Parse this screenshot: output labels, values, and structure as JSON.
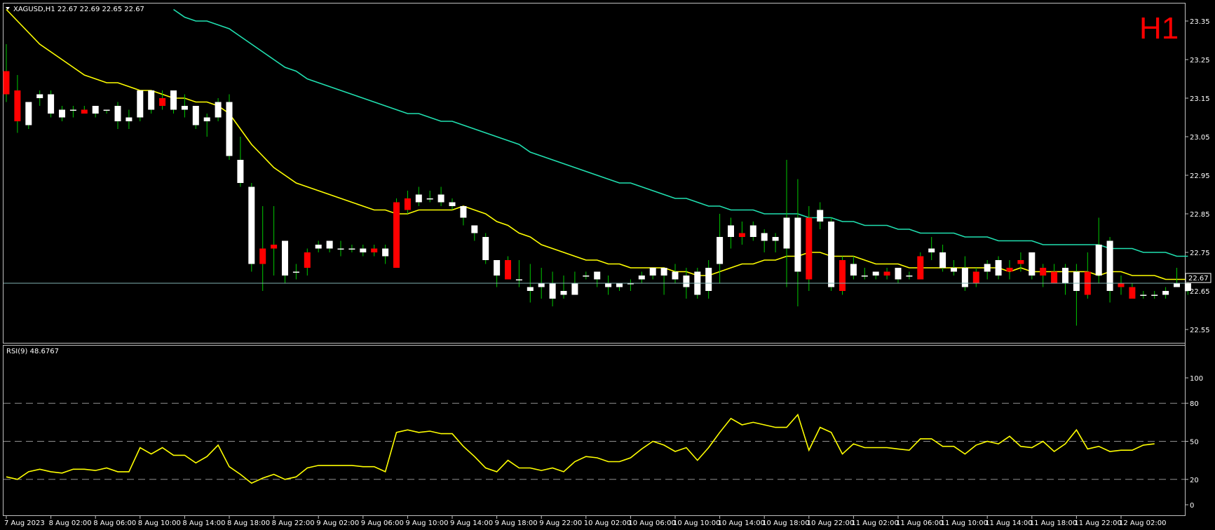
{
  "header": {
    "symbol_line": "XAGUSD,H1  22.67 22.69 22.65 22.67",
    "timeframe": "H1",
    "indicator_label": "RSI(9) 48.6767",
    "current_price": "22.67"
  },
  "colors": {
    "background": "#000000",
    "panel_border": "#c0c0c0",
    "bull_body": "#ffffff",
    "bear_body": "#ff0000",
    "wick": "#00c800",
    "ma_fast": "#ffff00",
    "ma_slow": "#20e0b0",
    "rsi_line": "#ffff00",
    "level_line": "#909090",
    "price_line": "#7fb0b0",
    "timeframe_label": "#ff0000"
  },
  "chart_data": [
    {
      "type": "candlestick",
      "name": "XAGUSD H1",
      "ylim": [
        22.5,
        23.38
      ],
      "y_ticks": [
        "23.35",
        "23.25",
        "23.15",
        "23.05",
        "22.95",
        "22.85",
        "22.75",
        "22.65",
        "22.55"
      ],
      "x_tick_labels": [
        "7 Aug 2023",
        "8 Aug 02:00",
        "8 Aug 06:00",
        "8 Aug 10:00",
        "8 Aug 14:00",
        "8 Aug 18:00",
        "8 Aug 22:00",
        "9 Aug 02:00",
        "9 Aug 06:00",
        "9 Aug 10:00",
        "9 Aug 14:00",
        "9 Aug 18:00",
        "9 Aug 22:00",
        "10 Aug 02:00",
        "10 Aug 06:00",
        "10 Aug 10:00",
        "10 Aug 14:00",
        "10 Aug 18:00",
        "10 Aug 22:00",
        "11 Aug 02:00",
        "11 Aug 06:00",
        "11 Aug 10:00",
        "11 Aug 14:00",
        "11 Aug 18:00",
        "11 Aug 22:00",
        "12 Aug 02:00"
      ],
      "current_price": 22.67,
      "candles": [
        [
          23.22,
          23.29,
          23.14,
          23.16
        ],
        [
          23.17,
          23.21,
          23.06,
          23.09
        ],
        [
          23.08,
          23.14,
          23.07,
          23.14
        ],
        [
          23.15,
          23.17,
          23.13,
          23.16
        ],
        [
          23.11,
          23.17,
          23.1,
          23.16
        ],
        [
          23.1,
          23.13,
          23.09,
          23.12
        ],
        [
          23.12,
          23.13,
          23.1,
          23.12
        ],
        [
          23.12,
          23.13,
          23.11,
          23.11
        ],
        [
          23.11,
          23.13,
          23.1,
          23.13
        ],
        [
          23.12,
          23.12,
          23.11,
          23.12
        ],
        [
          23.09,
          23.14,
          23.07,
          23.13
        ],
        [
          23.09,
          23.12,
          23.07,
          23.1
        ],
        [
          23.1,
          23.17,
          23.09,
          23.17
        ],
        [
          23.12,
          23.17,
          23.11,
          23.17
        ],
        [
          23.15,
          23.17,
          23.12,
          23.13
        ],
        [
          23.12,
          23.17,
          23.11,
          23.17
        ],
        [
          23.12,
          23.16,
          23.1,
          23.13
        ],
        [
          23.08,
          23.13,
          23.07,
          23.13
        ],
        [
          23.09,
          23.11,
          23.05,
          23.1
        ],
        [
          23.1,
          23.15,
          23.09,
          23.14
        ],
        [
          23.0,
          23.16,
          22.99,
          23.14
        ],
        [
          22.93,
          23.05,
          22.92,
          22.99
        ],
        [
          22.72,
          22.93,
          22.7,
          22.92
        ],
        [
          22.76,
          22.87,
          22.65,
          22.72
        ],
        [
          22.77,
          22.87,
          22.69,
          22.76
        ],
        [
          22.69,
          22.78,
          22.67,
          22.78
        ],
        [
          22.7,
          22.72,
          22.68,
          22.7
        ],
        [
          22.75,
          22.76,
          22.69,
          22.71
        ],
        [
          22.76,
          22.78,
          22.75,
          22.77
        ],
        [
          22.76,
          22.78,
          22.75,
          22.78
        ],
        [
          22.76,
          22.78,
          22.74,
          22.76
        ],
        [
          22.76,
          22.77,
          22.75,
          22.76
        ],
        [
          22.75,
          22.77,
          22.74,
          22.76
        ],
        [
          22.76,
          22.77,
          22.74,
          22.75
        ],
        [
          22.74,
          22.77,
          22.72,
          22.76
        ],
        [
          22.88,
          22.89,
          22.71,
          22.71
        ],
        [
          22.89,
          22.91,
          22.85,
          22.86
        ],
        [
          22.88,
          22.92,
          22.87,
          22.9
        ],
        [
          22.89,
          22.91,
          22.88,
          22.89
        ],
        [
          22.88,
          22.92,
          22.87,
          22.9
        ],
        [
          22.87,
          22.89,
          22.86,
          22.88
        ],
        [
          22.84,
          22.87,
          22.82,
          22.87
        ],
        [
          22.8,
          22.82,
          22.78,
          22.82
        ],
        [
          22.73,
          22.8,
          22.72,
          22.79
        ],
        [
          22.69,
          22.73,
          22.66,
          22.73
        ],
        [
          22.73,
          22.74,
          22.68,
          22.68
        ],
        [
          22.68,
          22.73,
          22.66,
          22.68
        ],
        [
          22.65,
          22.72,
          22.62,
          22.66
        ],
        [
          22.66,
          22.71,
          22.63,
          22.67
        ],
        [
          22.63,
          22.7,
          22.61,
          22.67
        ],
        [
          22.64,
          22.69,
          22.63,
          22.65
        ],
        [
          22.64,
          22.7,
          22.64,
          22.67
        ],
        [
          22.69,
          22.7,
          22.68,
          22.69
        ],
        [
          22.68,
          22.7,
          22.66,
          22.7
        ],
        [
          22.66,
          22.69,
          22.64,
          22.67
        ],
        [
          22.66,
          22.67,
          22.65,
          22.67
        ],
        [
          22.67,
          22.68,
          22.65,
          22.67
        ],
        [
          22.68,
          22.7,
          22.67,
          22.69
        ],
        [
          22.69,
          22.71,
          22.68,
          22.71
        ],
        [
          22.69,
          22.71,
          22.64,
          22.71
        ],
        [
          22.68,
          22.72,
          22.67,
          22.7
        ],
        [
          22.66,
          22.71,
          22.63,
          22.69
        ],
        [
          22.64,
          22.71,
          22.63,
          22.7
        ],
        [
          22.65,
          22.73,
          22.63,
          22.71
        ],
        [
          22.72,
          22.85,
          22.67,
          22.79
        ],
        [
          22.79,
          22.84,
          22.76,
          22.82
        ],
        [
          22.8,
          22.83,
          22.77,
          22.79
        ],
        [
          22.79,
          22.83,
          22.78,
          22.82
        ],
        [
          22.78,
          22.81,
          22.75,
          22.8
        ],
        [
          22.78,
          22.8,
          22.75,
          22.79
        ],
        [
          22.76,
          22.99,
          22.66,
          22.84
        ],
        [
          22.7,
          22.94,
          22.61,
          22.84
        ],
        [
          22.84,
          22.87,
          22.65,
          22.68
        ],
        [
          22.83,
          22.88,
          22.81,
          22.86
        ],
        [
          22.66,
          22.84,
          22.65,
          22.83
        ],
        [
          22.73,
          22.74,
          22.64,
          22.65
        ],
        [
          22.69,
          22.74,
          22.68,
          22.72
        ],
        [
          22.69,
          22.71,
          22.68,
          22.69
        ],
        [
          22.69,
          22.7,
          22.68,
          22.7
        ],
        [
          22.7,
          22.71,
          22.68,
          22.69
        ],
        [
          22.68,
          22.71,
          22.67,
          22.71
        ],
        [
          22.69,
          22.7,
          22.68,
          22.69
        ],
        [
          22.74,
          22.75,
          22.68,
          22.68
        ],
        [
          22.75,
          22.79,
          22.73,
          22.76
        ],
        [
          22.71,
          22.77,
          22.7,
          22.75
        ],
        [
          22.7,
          22.73,
          22.69,
          22.71
        ],
        [
          22.66,
          22.74,
          22.65,
          22.71
        ],
        [
          22.7,
          22.71,
          22.66,
          22.67
        ],
        [
          22.7,
          22.73,
          22.68,
          22.72
        ],
        [
          22.69,
          22.74,
          22.68,
          22.73
        ],
        [
          22.71,
          22.73,
          22.68,
          22.7
        ],
        [
          22.73,
          22.75,
          22.7,
          22.72
        ],
        [
          22.69,
          22.73,
          22.68,
          22.75
        ],
        [
          22.71,
          22.72,
          22.66,
          22.69
        ],
        [
          22.7,
          22.72,
          22.67,
          22.67
        ],
        [
          22.67,
          22.72,
          22.64,
          22.71
        ],
        [
          22.65,
          22.72,
          22.56,
          22.7
        ],
        [
          22.7,
          22.75,
          22.63,
          22.64
        ],
        [
          22.69,
          22.84,
          22.67,
          22.77
        ],
        [
          22.65,
          22.79,
          22.62,
          22.78
        ],
        [
          22.67,
          22.69,
          22.64,
          22.66
        ],
        [
          22.66,
          22.67,
          22.63,
          22.63
        ],
        [
          22.64,
          22.65,
          22.63,
          22.64
        ],
        [
          22.64,
          22.65,
          22.63,
          22.64
        ],
        [
          22.64,
          22.66,
          22.63,
          22.65
        ],
        [
          22.66,
          22.71,
          22.66,
          22.67
        ],
        [
          22.65,
          22.69,
          22.64,
          22.67
        ]
      ],
      "ma_fast": [
        23.38,
        23.35,
        23.32,
        23.29,
        23.27,
        23.25,
        23.23,
        23.21,
        23.2,
        23.19,
        23.19,
        23.18,
        23.17,
        23.17,
        23.16,
        23.15,
        23.15,
        23.14,
        23.14,
        23.13,
        23.11,
        23.07,
        23.03,
        23.0,
        22.97,
        22.95,
        22.93,
        22.92,
        22.91,
        22.9,
        22.89,
        22.88,
        22.87,
        22.86,
        22.86,
        22.85,
        22.85,
        22.86,
        22.86,
        22.86,
        22.86,
        22.87,
        22.86,
        22.85,
        22.83,
        22.82,
        22.8,
        22.79,
        22.77,
        22.76,
        22.75,
        22.74,
        22.73,
        22.73,
        22.72,
        22.72,
        22.71,
        22.71,
        22.71,
        22.71,
        22.7,
        22.7,
        22.69,
        22.69,
        22.7,
        22.71,
        22.72,
        22.72,
        22.73,
        22.73,
        22.74,
        22.74,
        22.75,
        22.75,
        22.74,
        22.74,
        22.74,
        22.73,
        22.72,
        22.72,
        22.72,
        22.71,
        22.71,
        22.71,
        22.71,
        22.71,
        22.71,
        22.71,
        22.71,
        22.71,
        22.7,
        22.71,
        22.7,
        22.7,
        22.7,
        22.7,
        22.7,
        22.7,
        22.69,
        22.7,
        22.7,
        22.69,
        22.69,
        22.69,
        22.68,
        22.68,
        22.68
      ],
      "ma_slow": [
        null,
        null,
        null,
        null,
        null,
        null,
        null,
        null,
        null,
        null,
        null,
        null,
        null,
        null,
        null,
        23.38,
        23.36,
        23.35,
        23.35,
        23.34,
        23.33,
        23.31,
        23.29,
        23.27,
        23.25,
        23.23,
        23.22,
        23.2,
        23.19,
        23.18,
        23.17,
        23.16,
        23.15,
        23.14,
        23.13,
        23.12,
        23.11,
        23.11,
        23.1,
        23.09,
        23.09,
        23.08,
        23.07,
        23.06,
        23.05,
        23.04,
        23.03,
        23.01,
        23.0,
        22.99,
        22.98,
        22.97,
        22.96,
        22.95,
        22.94,
        22.93,
        22.93,
        22.92,
        22.91,
        22.9,
        22.89,
        22.89,
        22.88,
        22.87,
        22.87,
        22.86,
        22.86,
        22.86,
        22.85,
        22.85,
        22.85,
        22.85,
        22.84,
        22.84,
        22.84,
        22.83,
        22.83,
        22.82,
        22.82,
        22.82,
        22.81,
        22.81,
        22.8,
        22.8,
        22.8,
        22.8,
        22.79,
        22.79,
        22.79,
        22.78,
        22.78,
        22.78,
        22.78,
        22.77,
        22.77,
        22.77,
        22.77,
        22.77,
        22.77,
        22.76,
        22.76,
        22.76,
        22.75,
        22.75,
        22.75,
        22.74,
        22.74
      ]
    },
    {
      "type": "line",
      "name": "RSI(9)",
      "ylim": [
        0,
        100
      ],
      "y_ticks": [
        "100",
        "80",
        "50",
        "20",
        "0"
      ],
      "levels": [
        80,
        50,
        20
      ],
      "values": [
        22,
        20,
        26,
        28,
        26,
        25,
        28,
        28,
        27,
        29,
        26,
        26,
        45,
        40,
        45,
        39,
        39,
        33,
        38,
        47,
        30,
        24,
        17,
        21,
        24,
        20,
        22,
        29,
        31,
        31,
        31,
        31,
        30,
        30,
        26,
        57,
        59,
        57,
        58,
        56,
        56,
        46,
        38,
        29,
        26,
        35,
        29,
        29,
        27,
        29,
        26,
        34,
        38,
        37,
        34,
        34,
        37,
        44,
        50,
        47,
        42,
        45,
        35,
        45,
        57,
        68,
        63,
        65,
        63,
        61,
        61,
        71,
        43,
        61,
        57,
        40,
        48,
        45,
        45,
        45,
        44,
        43,
        52,
        52,
        46,
        46,
        40,
        47,
        50,
        48,
        54,
        46,
        45,
        50,
        42,
        48,
        59,
        44,
        46,
        42,
        43,
        43,
        47,
        48
      ]
    }
  ]
}
